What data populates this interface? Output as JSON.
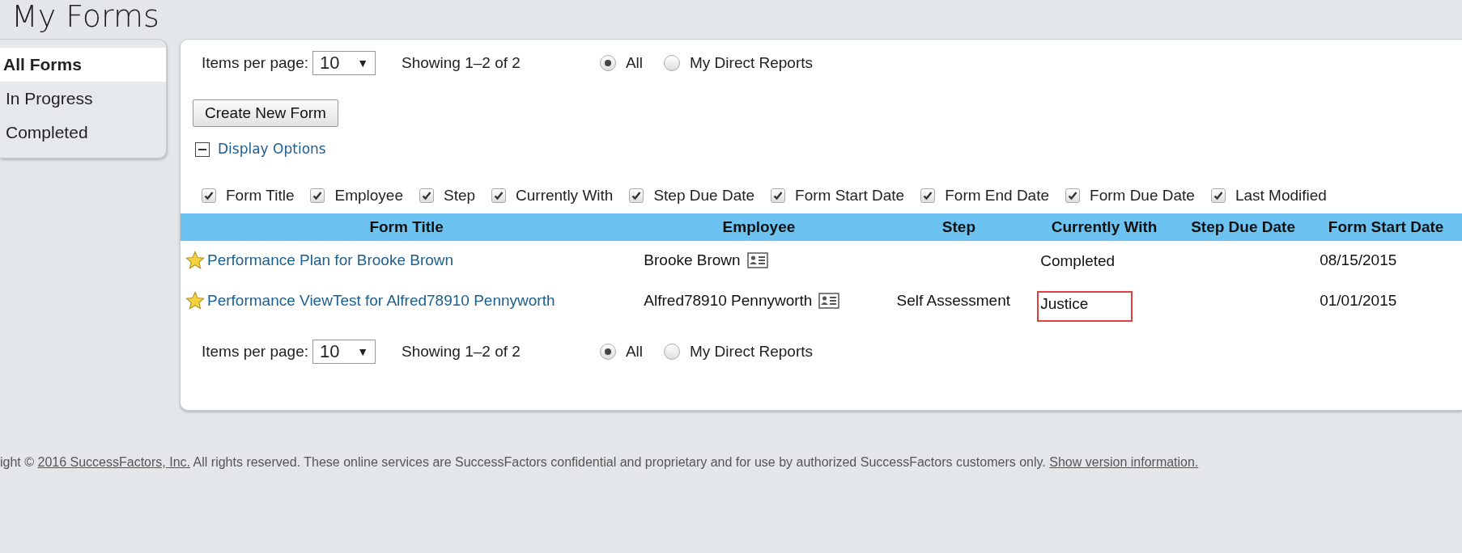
{
  "page_title": "My Forms",
  "sidebar": {
    "items": [
      {
        "label": "All Forms",
        "selected": true
      },
      {
        "label": "In Progress",
        "selected": false
      },
      {
        "label": "Completed",
        "selected": false
      }
    ]
  },
  "pagination_top": {
    "label": "Items per page:",
    "value": "10",
    "arrow": "▼",
    "showing": "Showing 1–2 of 2",
    "radios": [
      {
        "label": "All",
        "selected": true
      },
      {
        "label": "My Direct Reports",
        "selected": false
      }
    ]
  },
  "create_button": "Create New Form",
  "display_options": {
    "label": "Display Options",
    "expanded": true,
    "columns": [
      {
        "label": "Form Title",
        "checked": true
      },
      {
        "label": "Employee",
        "checked": true
      },
      {
        "label": "Step",
        "checked": true
      },
      {
        "label": "Currently With",
        "checked": true
      },
      {
        "label": "Step Due Date",
        "checked": true
      },
      {
        "label": "Form Start Date",
        "checked": true
      },
      {
        "label": "Form End Date",
        "checked": true
      },
      {
        "label": "Form Due Date",
        "checked": true
      },
      {
        "label": "Last Modified",
        "checked": true
      }
    ]
  },
  "table": {
    "columns": [
      "Form Title",
      "Employee",
      "Step",
      "Currently With",
      "Step Due Date",
      "Form Start Date"
    ],
    "rows": [
      {
        "form_title": "Performance Plan for Brooke Brown",
        "employee": "Brooke Brown",
        "step": "",
        "currently_with": "Completed",
        "highlighted": false,
        "step_due_date": "",
        "form_start_date": "08/15/2015"
      },
      {
        "form_title": "Performance ViewTest for Alfred78910 Pennyworth",
        "employee": "Alfred78910 Pennyworth",
        "step": "Self Assessment",
        "currently_with": "Justice",
        "highlighted": true,
        "step_due_date": "",
        "form_start_date": "01/01/2015"
      }
    ]
  },
  "pagination_bottom": {
    "label": "Items per page:",
    "value": "10",
    "arrow": "▼",
    "showing": "Showing 1–2 of 2",
    "radios": [
      {
        "label": "All",
        "selected": true
      },
      {
        "label": "My Direct Reports",
        "selected": false
      }
    ]
  },
  "footer": {
    "prefix": "ight ©",
    "link": "2016 SuccessFactors, Inc.",
    "text": "All rights reserved. These online services are SuccessFactors confidential and proprietary and for use by authorized SuccessFactors customers only.",
    "version_link": "Show version information."
  }
}
